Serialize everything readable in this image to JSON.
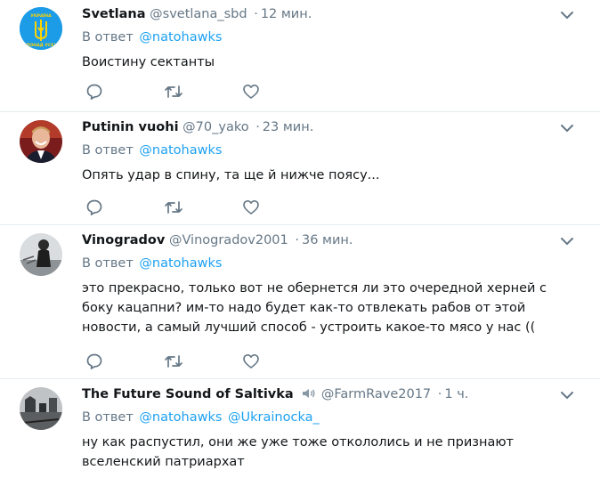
{
  "colors": {
    "accent": "#1da1f2",
    "muted": "#657786",
    "text": "#14171a",
    "divider": "#e6ecf0"
  },
  "icons": {
    "reply": "reply-icon",
    "retweet": "retweet-icon",
    "like": "heart-icon",
    "menu": "chevron-down-icon",
    "audio": "speaker-icon"
  },
  "tweets": [
    {
      "name": "Svetlana",
      "handle": "@svetlana_sbd",
      "separator": "·",
      "time": "12 мин.",
      "reply_prefix": "В ответ",
      "mentions": [
        "@natohawks"
      ],
      "text": "Воистину сектанты",
      "avatar_text_top": "УКРАЇНА",
      "avatar_text_bottom": "ПОНАД УСЕ!"
    },
    {
      "name": "Putinin vuohi",
      "handle": "@70_yako",
      "separator": "·",
      "time": "23 мин.",
      "reply_prefix": "В ответ",
      "mentions": [
        "@natohawks"
      ],
      "text": "Опять удар в спину, та ще й нижче поясу..."
    },
    {
      "name": "Vinogradov",
      "handle": "@Vinogradov2001",
      "separator": "·",
      "time": "36 мин.",
      "reply_prefix": "В ответ",
      "mentions": [
        "@natohawks"
      ],
      "text": "это прекрасно, только вот не обернется ли это очередной херней с боку кацапни? им-то надо будет как-то отвлекать рабов от этой новости, а самый лучший способ - устроить какое-то мясо у нас (("
    },
    {
      "name": "The Future Sound of Saltivka",
      "handle": "@FarmRave2017",
      "separator": "·",
      "time": "1 ч.",
      "reply_prefix": "В ответ",
      "mentions": [
        "@natohawks",
        "@Ukrainocka_"
      ],
      "text": "ну как распустил, они же уже тоже откололись и не признают вселенский патриархат"
    }
  ]
}
